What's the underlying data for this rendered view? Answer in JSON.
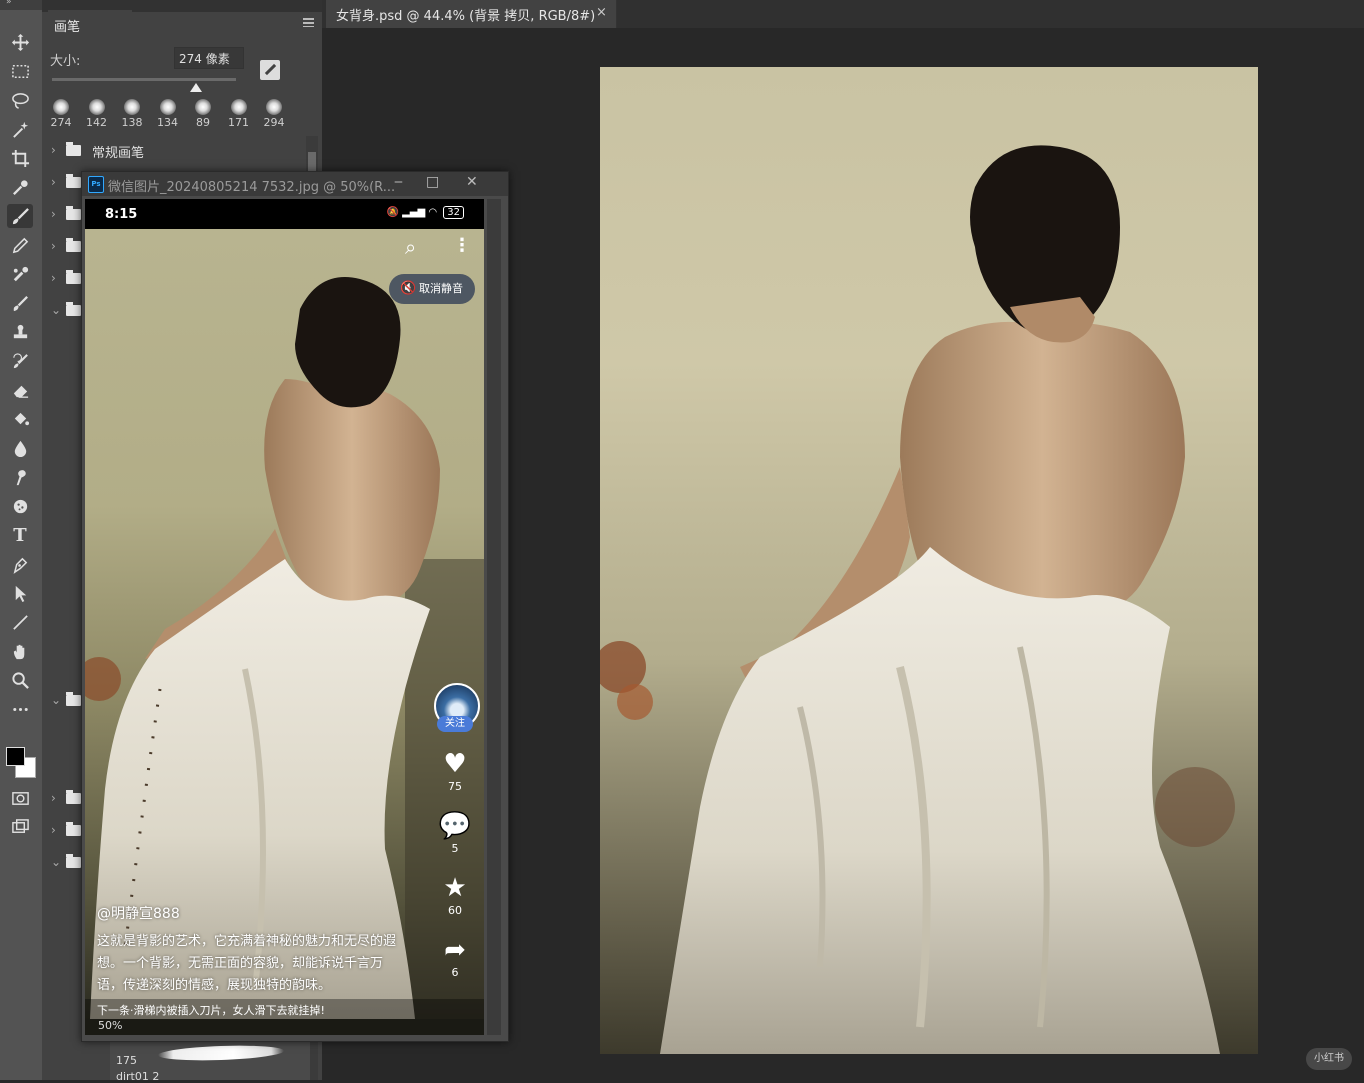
{
  "window": {
    "doc_tab_title": "女背身.psd @ 44.4% (背景 拷贝, RGB/8#)",
    "doc_tab_close": "×"
  },
  "brush_panel": {
    "tab_label": "画笔",
    "size_label": "大小:",
    "size_value": "274 像素",
    "presets": [
      "274",
      "142",
      "138",
      "134",
      "89",
      "171",
      "294"
    ],
    "folders": [
      {
        "label": "常规画笔"
      }
    ],
    "bottom_brush_size": "175",
    "bottom_brush_name": "dirt01 2"
  },
  "float_window": {
    "title": "微信图片_20240805214 7532.jpg @ 50%(R...",
    "zoom": "50%",
    "phone": {
      "time": "8:15",
      "battery": "32",
      "mute_label": "取消静音",
      "follow_label": "关注",
      "likes": "75",
      "comments": "5",
      "favorites": "60",
      "shares": "6",
      "username": "@明静宣888",
      "caption": "这就是背影的艺术，它充满着神秘的魅力和无尽的遐想。一个背影，无需正面的容貌，却能诉说千言万语，传递深刻的情感，展现独特的韵味。",
      "next_text": "下一条·滑梯内被插入刀片，女人滑下去就挂掉!"
    }
  },
  "watermark": "小红书",
  "colors": {
    "accent": "#31a8ff",
    "follow_badge": "#4a7bd8",
    "foreground_swatch": "#000000",
    "background_swatch": "#ffffff"
  },
  "icons": [
    "move-icon",
    "marquee-icon",
    "lasso-icon",
    "magic-wand-icon",
    "crop-icon",
    "eyedropper-icon",
    "brush-icon",
    "pencil-icon",
    "spot-heal-icon",
    "mixer-brush-icon",
    "clone-stamp-icon",
    "history-brush-icon",
    "eraser-icon",
    "paint-bucket-icon",
    "blur-icon",
    "smudge-icon",
    "sponge-icon",
    "type-icon",
    "pen-icon",
    "path-select-icon",
    "line-icon",
    "hand-icon",
    "zoom-icon",
    "more-icon",
    "search-icon",
    "more-vertical-icon",
    "speaker-mute-icon",
    "heart-icon",
    "comment-icon",
    "star-icon",
    "share-icon"
  ]
}
